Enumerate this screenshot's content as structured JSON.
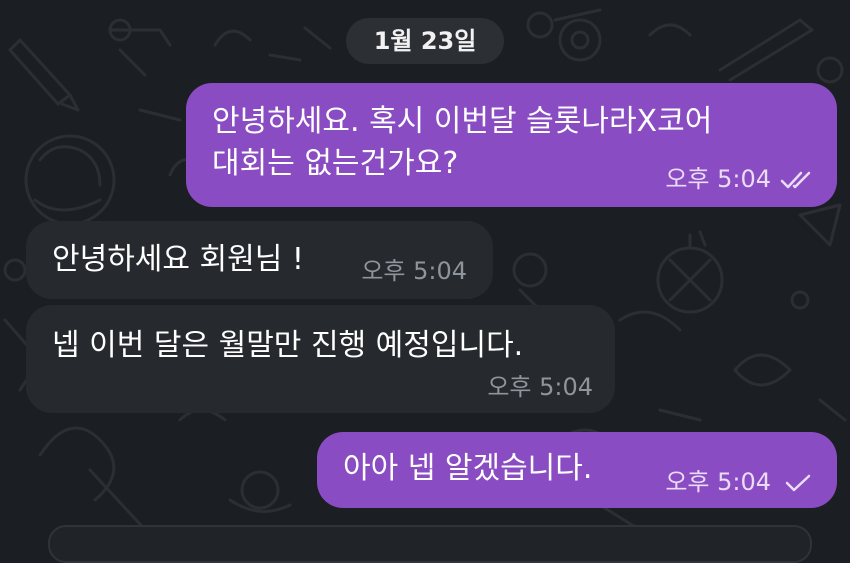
{
  "date_separator": "1월 23일",
  "messages": [
    {
      "direction": "outgoing",
      "lines": [
        "안녕하세요. 혹시 이번달 슬롯나라X코어",
        "대회는 없는건가요?"
      ],
      "time": "오후 5:04",
      "status_icon": "double-check-icon",
      "status": "read"
    },
    {
      "direction": "incoming",
      "lines": [
        "안녕하세요 회원님 !"
      ],
      "time": "오후 5:04"
    },
    {
      "direction": "incoming",
      "lines": [
        "넵 이번 달은 월말만 진행 예정입니다."
      ],
      "time": "오후 5:04"
    },
    {
      "direction": "outgoing",
      "lines": [
        "아아 넵 알겠습니다."
      ],
      "time": "오후 5:04",
      "status_icon": "single-check-icon",
      "status": "sent"
    }
  ],
  "colors": {
    "background": "#1b1e22",
    "outgoing_bubble": "#8a4cc2",
    "incoming_bubble": "#26292e",
    "date_pill": "#2c3035"
  }
}
